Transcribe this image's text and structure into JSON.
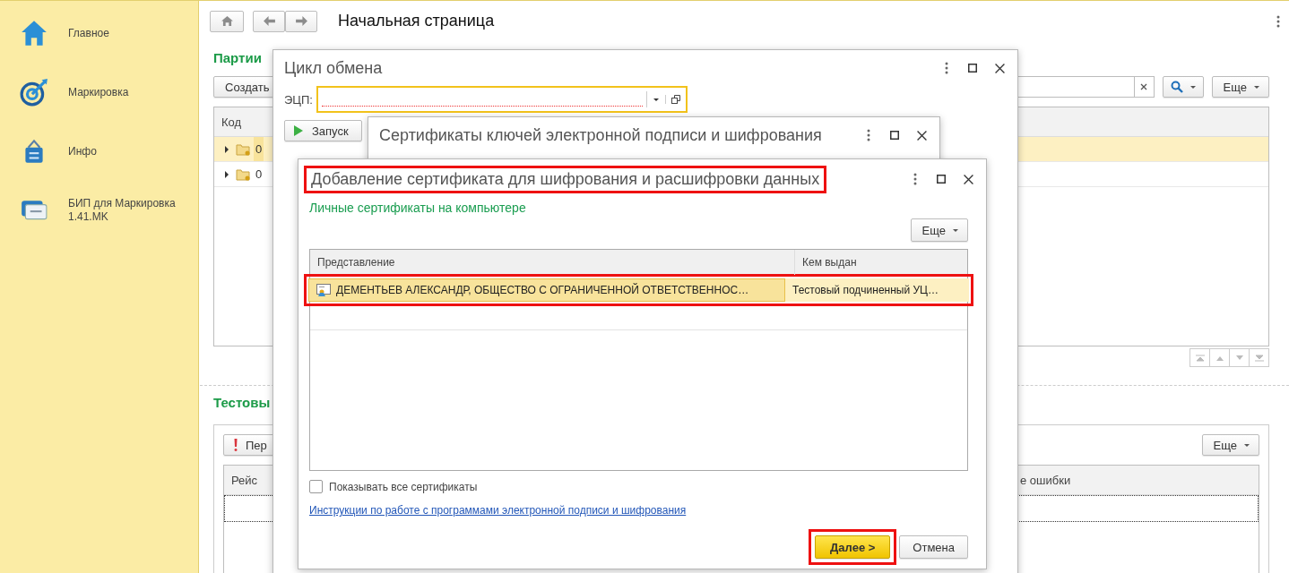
{
  "sidebar": {
    "items": [
      {
        "label": "Главное"
      },
      {
        "label": "Маркировка"
      },
      {
        "label": "Инфо"
      },
      {
        "label": "БИП для Маркировка 1.41.MK"
      }
    ]
  },
  "page": {
    "title": "Начальная страница"
  },
  "section_1": {
    "title": "Партии",
    "create_button": "Создать",
    "more_button": "Еще",
    "table": {
      "columns": [
        "Код"
      ],
      "rows": [
        {
          "code": "0",
          "selected": true
        },
        {
          "code": "0",
          "selected": false
        }
      ]
    }
  },
  "section_2": {
    "title": "Тестовы",
    "toolbar_button": "Пер",
    "more_button": "Еще",
    "table": {
      "columns": [
        "Рейс",
        "е ошибки"
      ]
    }
  },
  "exchange_dialog": {
    "title": "Цикл обмена",
    "field_label": "ЭЦП:",
    "run_button": "Запуск"
  },
  "certificates_dialog": {
    "title": "Сертификаты ключей электронной подписи и шифрования"
  },
  "add_dialog": {
    "title": "Добавление сертификата для шифрования и расшифровки данных",
    "title_highlighted": true,
    "subtitle": "Личные сертификаты на компьютере",
    "more_button": "Еще",
    "table": {
      "columns": [
        "Представление",
        "Кем выдан"
      ],
      "rows": [
        {
          "presentation": "ДЕМЕНТЬЕВ АЛЕКСАНДР, ОБЩЕСТВО С ОГРАНИЧЕННОЙ ОТВЕТСТВЕННОС…",
          "issuer": "Тестовый подчиненный УЦ…",
          "selected": true,
          "highlighted": true
        }
      ]
    },
    "show_all": {
      "label": "Показывать все сертификаты",
      "checked": false
    },
    "link": "Инструкции по работе с программами электронной подписи и шифрования",
    "buttons": [
      {
        "label": "Далее >",
        "kind": "primary",
        "highlighted": true
      },
      {
        "label": "Отмена",
        "kind": "secondary",
        "highlighted": false
      }
    ]
  }
}
